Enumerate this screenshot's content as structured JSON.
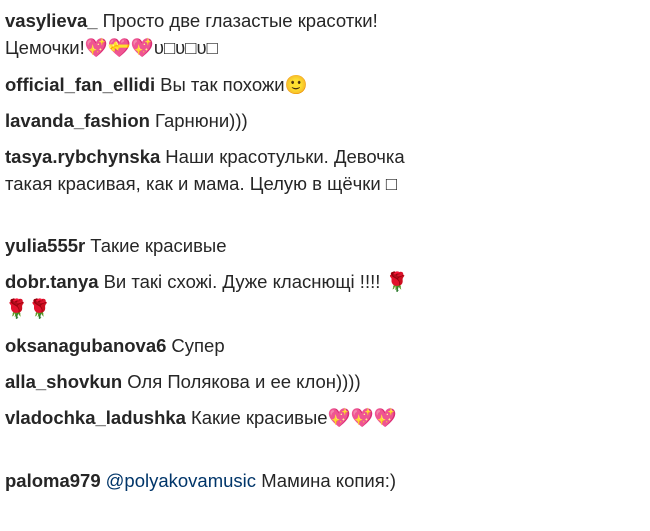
{
  "comments": [
    {
      "username": "vasylieva_",
      "text": "Просто две глазастые красотки! Цемочки!💖💝💖υ□υ□υ□"
    },
    {
      "username": "official_fan_ellidi",
      "text": "Вы так похожи🙂"
    },
    {
      "username": "lavanda_fashion",
      "text": "Гарнюни)))"
    },
    {
      "username": "tasya.rybchynska",
      "text": "Наши красотульки. Девочка такая красивая, как и мама. Целую в щёчки □"
    },
    {
      "username": "yulia555r",
      "text": "Такие красивые"
    },
    {
      "username": "dobr.tanya",
      "text": "Ви такі схожі. Дуже класнющі !!!! 🌹🌹🌹"
    },
    {
      "username": "oksanagubanova6",
      "text": "Супер"
    },
    {
      "username": "alla_shovkun",
      "text": "Оля Полякова и ее клон))))"
    },
    {
      "username": "vladochka_ladushka",
      "text": "Какие красивые💖💖💖"
    },
    {
      "username": "paloma979",
      "mention": "@polyakovamusic",
      "text": "Мамина копия:)"
    }
  ]
}
